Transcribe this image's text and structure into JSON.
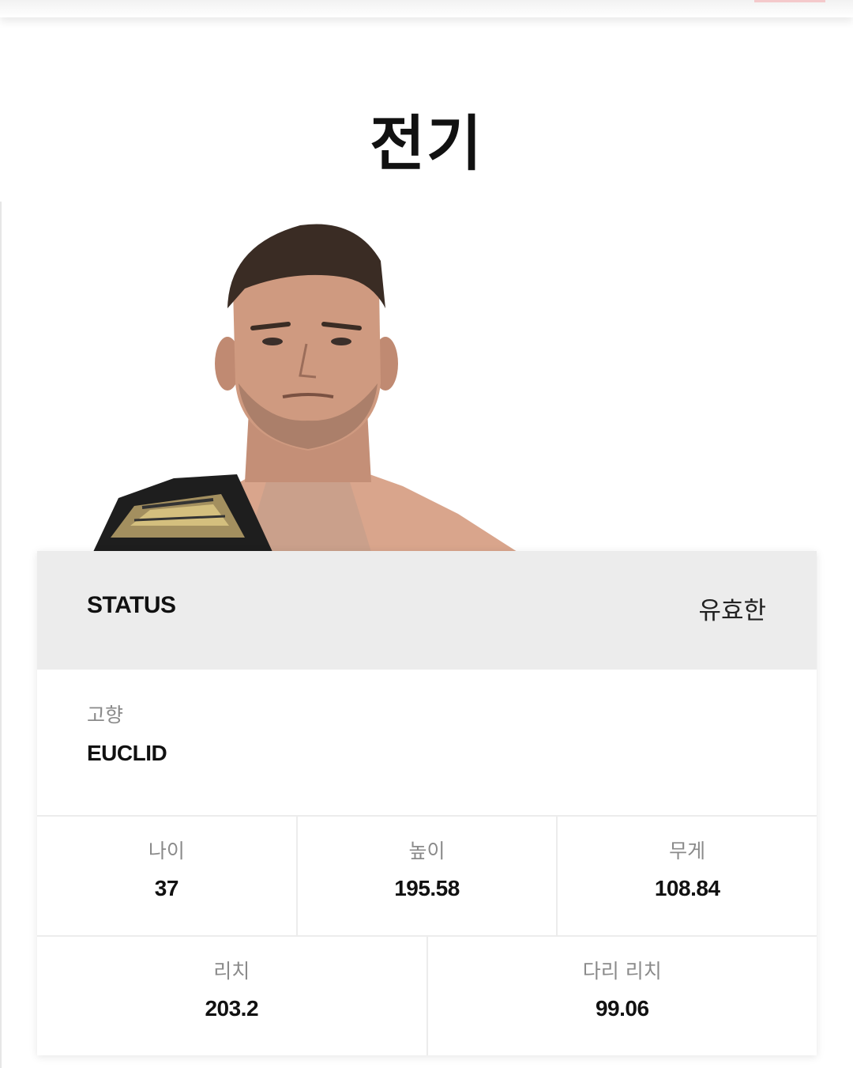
{
  "page": {
    "title": "전기"
  },
  "profile": {
    "image_alt": "fighter-portrait-with-championship-belt"
  },
  "status": {
    "label": "STATUS",
    "value": "유효한"
  },
  "hometown": {
    "label": "고향",
    "value": "EUCLID"
  },
  "stats_row1": [
    {
      "label": "나이",
      "value": "37"
    },
    {
      "label": "높이",
      "value": "195.58"
    },
    {
      "label": "무게",
      "value": "108.84"
    }
  ],
  "stats_row2": [
    {
      "label": "리치",
      "value": "203.2"
    },
    {
      "label": "다리 리치",
      "value": "99.06"
    }
  ],
  "colors": {
    "status_bg": "#ececec",
    "label_gray": "#8a8a8a",
    "text_dark": "#111111",
    "topbar_accent": "#f4c9cb"
  }
}
